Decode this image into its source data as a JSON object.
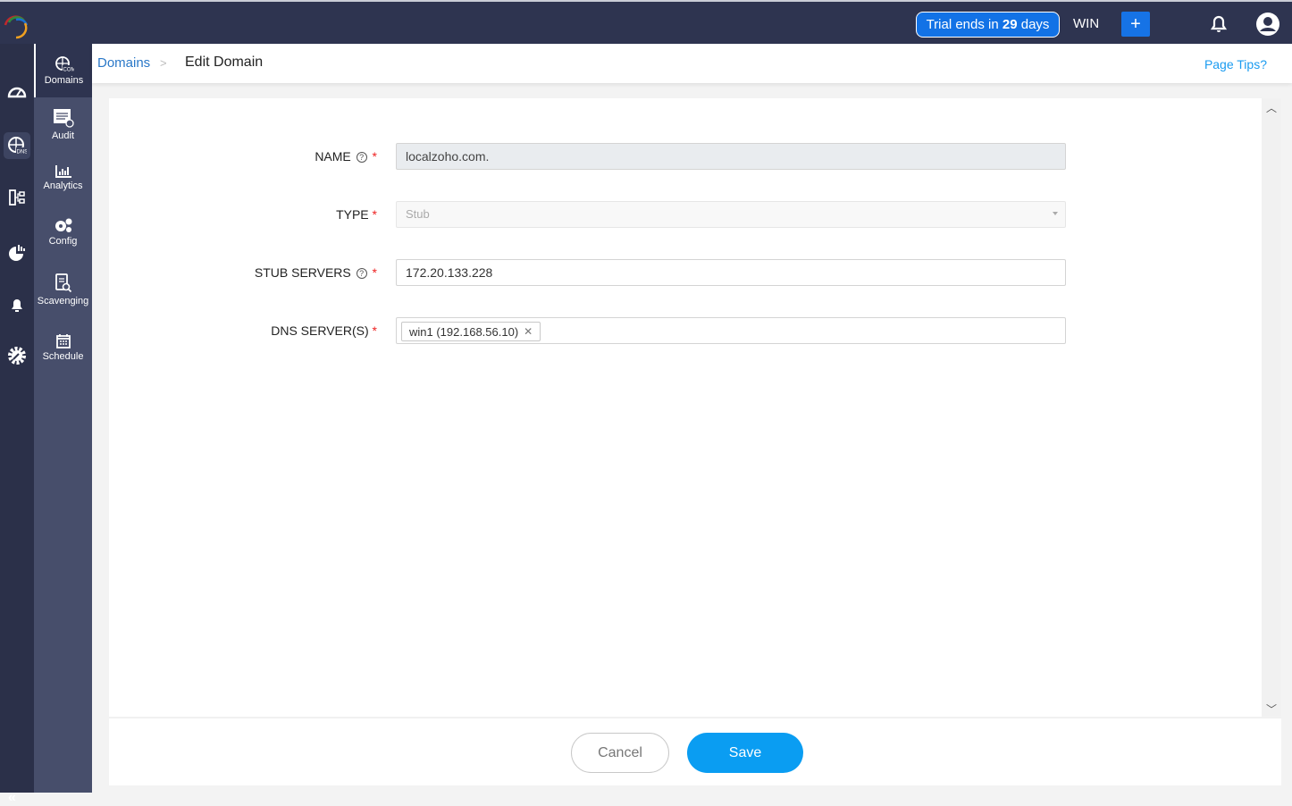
{
  "topbar": {
    "trial_prefix": "Trial ends in ",
    "trial_days": "29",
    "trial_suffix": " days",
    "workspace": "WIN",
    "add_label": "+"
  },
  "submenu": [
    {
      "label": "Domains",
      "icon": "globe-com-icon",
      "active": true
    },
    {
      "label": "Audit",
      "icon": "audit-icon"
    },
    {
      "label": "Analytics",
      "icon": "bar-chart-icon"
    },
    {
      "label": "Config",
      "icon": "gears-icon"
    },
    {
      "label": "Scavenging",
      "icon": "doc-search-icon"
    },
    {
      "label": "Schedule",
      "icon": "calendar-icon"
    }
  ],
  "breadcrumb": {
    "parent": "Domains",
    "separator": ">",
    "current": "Edit Domain"
  },
  "header": {
    "page_tips": "Page Tips?"
  },
  "form": {
    "name": {
      "label": "NAME",
      "value": "localzoho.com."
    },
    "type": {
      "label": "TYPE",
      "value": "Stub"
    },
    "stub_servers": {
      "label": "STUB SERVERS",
      "value": "172.20.133.228"
    },
    "dns_servers": {
      "label": "DNS SERVER(S)",
      "tags": [
        "win1 (192.168.56.10)"
      ]
    },
    "required_mark": "*",
    "help_mark": "?",
    "remove_mark": "✕"
  },
  "footer": {
    "cancel": "Cancel",
    "save": "Save"
  },
  "collapse_label": "«"
}
